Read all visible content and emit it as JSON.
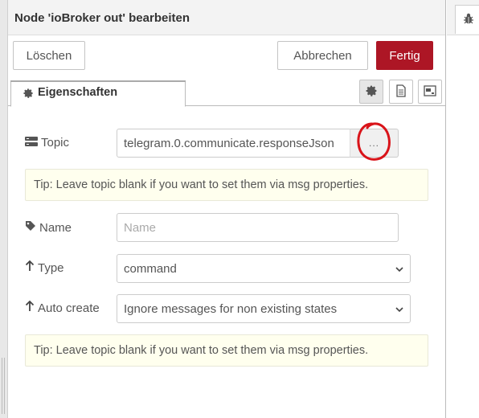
{
  "tray": {
    "title": "Node 'ioBroker out' bearbeiten",
    "buttons": {
      "delete": "Löschen",
      "cancel": "Abbrechen",
      "done": "Fertig"
    },
    "tabs": [
      {
        "label": "Eigenschaften",
        "icon": "gear-icon"
      }
    ],
    "tab_icon_buttons": [
      "gear-icon",
      "document-icon",
      "appearance-icon"
    ]
  },
  "form": {
    "topic": {
      "label": "Topic",
      "value": "telegram.0.communicate.responseJson",
      "browse": "..."
    },
    "tip1": "Tip: Leave topic blank if you want to set them via msg properties.",
    "name": {
      "label": "Name",
      "placeholder": "Name"
    },
    "type": {
      "label": "Type",
      "value": "command"
    },
    "auto_create": {
      "label": "Auto create",
      "value": "Ignore messages for non existing states"
    },
    "tip2": "Tip: Leave topic blank if you want to set them via msg properties."
  },
  "colors": {
    "done_button": "#ad1625",
    "tip_background": "#ffffee",
    "annotation_circle": "#d9141a"
  }
}
